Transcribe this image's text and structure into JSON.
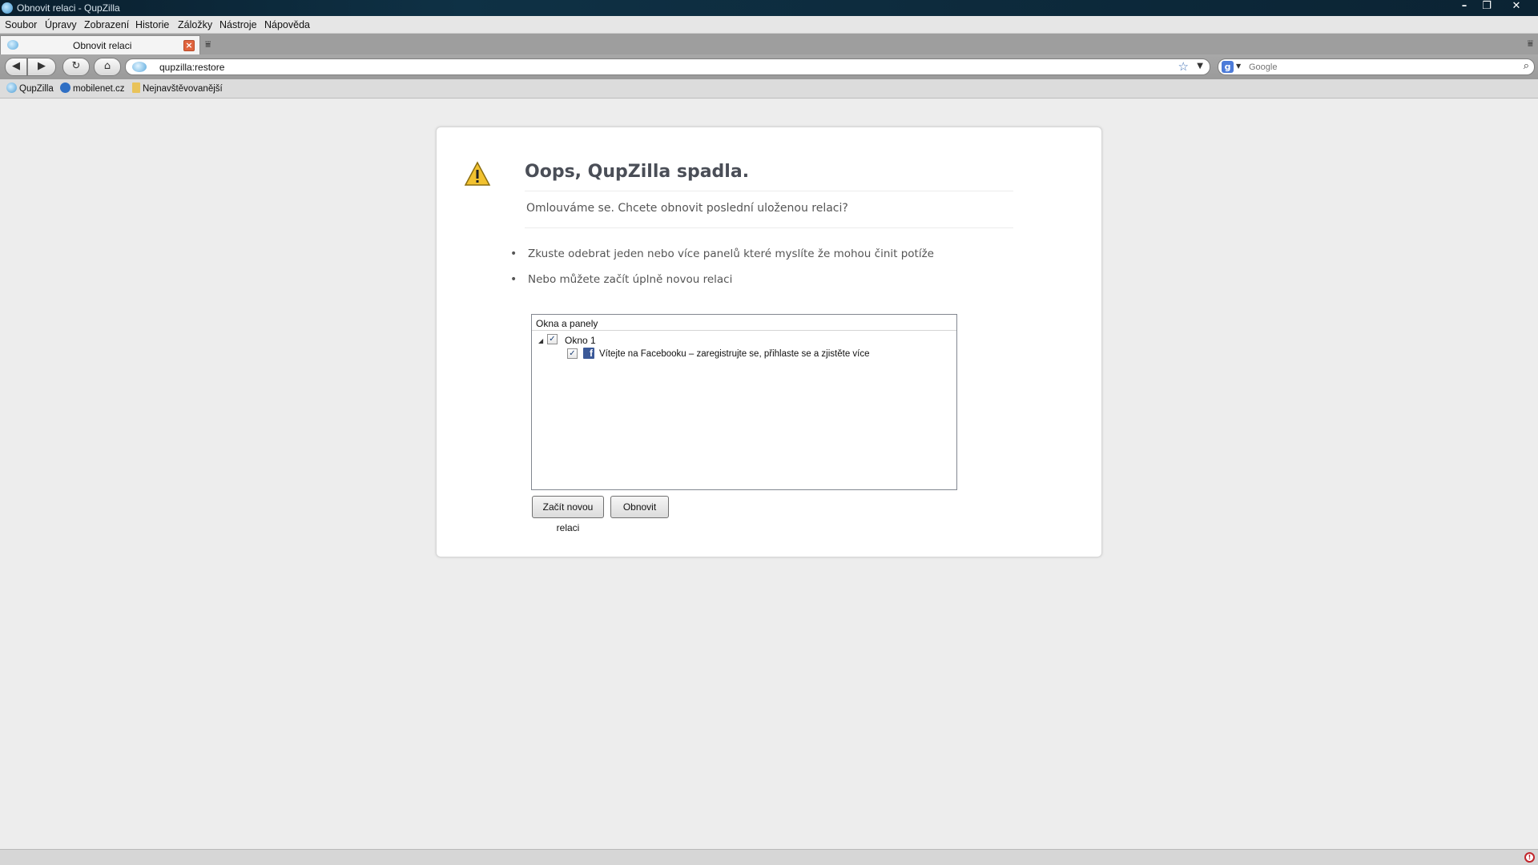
{
  "window": {
    "title": "Obnovit relaci - QupZilla"
  },
  "menu": [
    "Soubor",
    "Úpravy",
    "Zobrazení",
    "Historie",
    "Záložky",
    "Nástroje",
    "Nápověda"
  ],
  "tab": {
    "title": "Obnovit relaci",
    "close": "×"
  },
  "navigation": {
    "url": "qupzilla:restore"
  },
  "search": {
    "engine": "g",
    "placeholder": "Google"
  },
  "bookmarks": [
    {
      "label": "QupZilla"
    },
    {
      "label": "mobilenet.cz"
    },
    {
      "label": "Nejnavštěvovanější"
    }
  ],
  "page": {
    "heading": "Oops, QupZilla spadla.",
    "subheading": "Omlouváme se. Chcete obnovit poslední uloženou relaci?",
    "bullets": [
      "Zkuste odebrat jeden nebo více panelů které myslíte že mohou činit potíže",
      "Nebo můžete začít úplně novou relaci"
    ],
    "tree": {
      "header": "Okna a panely",
      "window_label": "Okno 1",
      "tab_label": "Vítejte na Facebooku – zaregistrujte se, přihlaste se a zjistěte více"
    },
    "buttons": {
      "new_session": "Začít novou relaci",
      "restore": "Obnovit"
    }
  },
  "colors": {
    "accent": "#3d6fb5",
    "heading": "#4a4e57",
    "facebook": "#3b5998",
    "tab_close": "#e0643e"
  }
}
